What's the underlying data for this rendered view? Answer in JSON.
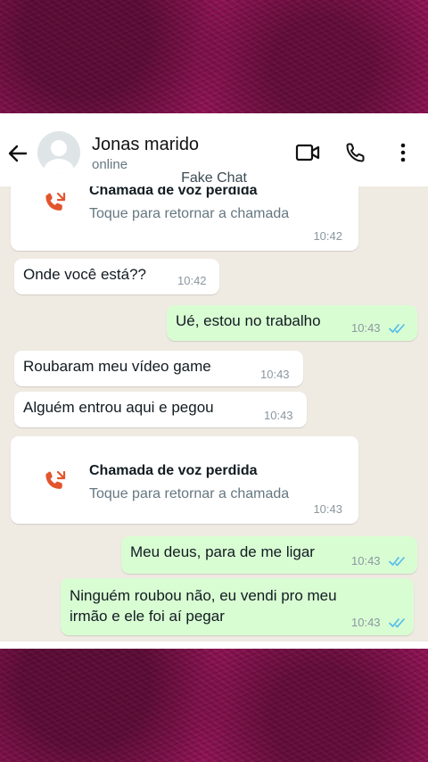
{
  "header": {
    "contact_name": "Jonas marido",
    "status": "online",
    "app_label": "Fake Chat"
  },
  "messages": [
    {
      "type": "call",
      "title": "Chamada de voz perdida",
      "subtitle": "Toque para retornar a chamada",
      "time": "10:42",
      "direction": "in"
    },
    {
      "type": "text",
      "text": "Onde você está??",
      "time": "10:42",
      "direction": "in"
    },
    {
      "type": "text",
      "text": "Ué, estou no trabalho",
      "time": "10:43",
      "direction": "out",
      "read": true
    },
    {
      "type": "text",
      "text": "Roubaram meu vídeo game",
      "time": "10:43",
      "direction": "in"
    },
    {
      "type": "text",
      "text": "Alguém entrou aqui e pegou",
      "time": "10:43",
      "direction": "in"
    },
    {
      "type": "call",
      "title": "Chamada de voz perdida",
      "subtitle": "Toque para retornar a chamada",
      "time": "10:43",
      "direction": "in"
    },
    {
      "type": "text",
      "text": "Meu deus, para de me ligar",
      "time": "10:43",
      "direction": "out",
      "read": true
    },
    {
      "type": "text",
      "text": "Ninguém roubou não, eu vendi pro meu irmão e ele foi aí pegar",
      "time": "10:43",
      "direction": "out",
      "read": true
    }
  ],
  "colors": {
    "incoming_bubble": "#ffffff",
    "outgoing_bubble": "#d9fdd3",
    "chat_background": "#efeae2",
    "missed_call_icon": "#e2552d",
    "read_check": "#53bdeb",
    "frame": "#8e1253"
  }
}
